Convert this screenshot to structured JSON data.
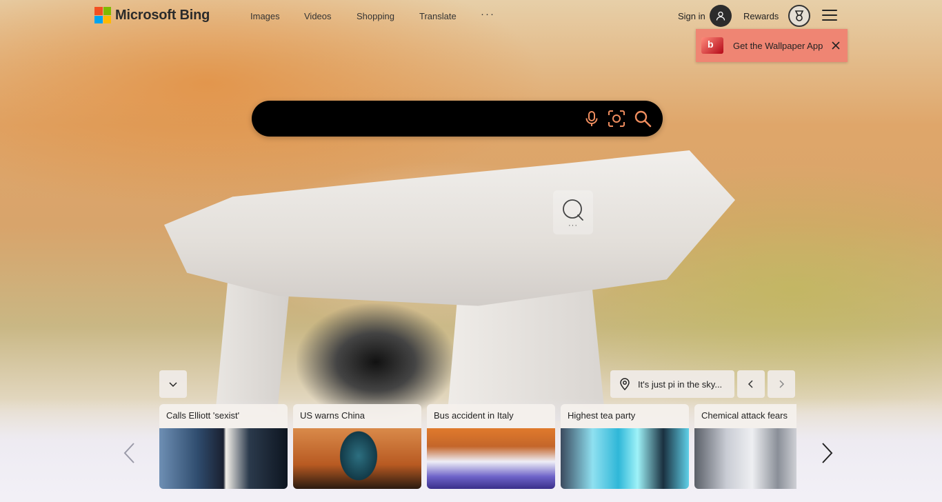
{
  "brand": {
    "name": "Microsoft Bing",
    "logo_colors": [
      "#f25022",
      "#7fba00",
      "#00a4ef",
      "#ffb900"
    ]
  },
  "nav": {
    "items": [
      {
        "label": "Images"
      },
      {
        "label": "Videos"
      },
      {
        "label": "Shopping"
      },
      {
        "label": "Translate"
      }
    ],
    "more_label": "···"
  },
  "account": {
    "signin_label": "Sign in",
    "rewards_label": "Rewards"
  },
  "promo": {
    "label": "Get the Wallpaper App",
    "icon_letter": "b",
    "color": "#ef8573"
  },
  "search": {
    "value": "",
    "placeholder": ""
  },
  "hotspot": {
    "dots": "···"
  },
  "image_info": {
    "location_text": "It's just pi in the sky..."
  },
  "news": {
    "cards": [
      {
        "title": "Calls Elliott 'sexist'"
      },
      {
        "title": "US warns China"
      },
      {
        "title": "Bus accident in Italy"
      },
      {
        "title": "Highest tea party"
      },
      {
        "title": "Chemical attack fears"
      }
    ]
  }
}
